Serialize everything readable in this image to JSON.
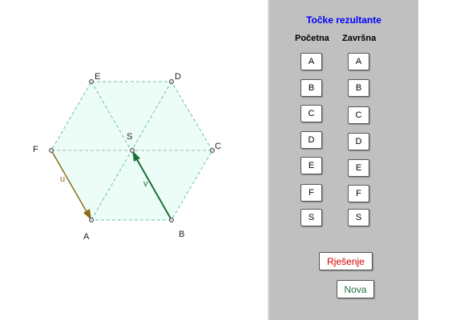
{
  "panel": {
    "title": "Točke rezultante",
    "col_start": "Početna",
    "col_end": "Završna",
    "start_buttons": [
      "A",
      "B",
      "C",
      "D",
      "E",
      "F",
      "S"
    ],
    "end_buttons": [
      "A",
      "B",
      "C",
      "D",
      "E",
      "F",
      "S"
    ],
    "solution_label": "Rješenje",
    "new_label": "Nova"
  },
  "figure": {
    "points": {
      "A": "A",
      "B": "B",
      "C": "C",
      "D": "D",
      "E": "E",
      "F": "F",
      "S": "S"
    },
    "vectors": {
      "u": "u",
      "v": "v"
    }
  },
  "colors": {
    "fill": "#ebfdf6",
    "dash": "#6fbfa7",
    "vector_u": "#8a6d18",
    "vector_v": "#1f6f3a",
    "solution_text": "#cc0000",
    "new_text": "#207040",
    "title_text": "#0000ff"
  }
}
